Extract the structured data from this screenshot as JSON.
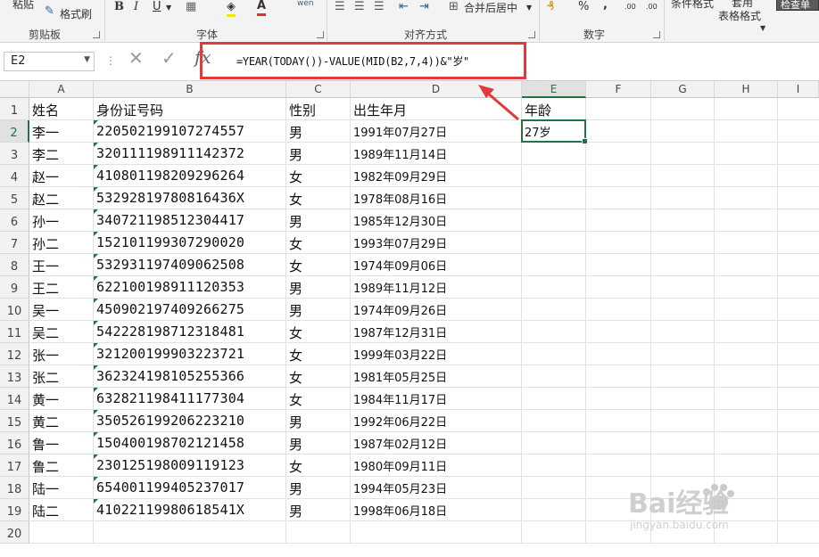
{
  "ribbon": {
    "clipboard": {
      "paste": "粘贴",
      "format_painter": "格式刷",
      "group": "剪贴板"
    },
    "font": {
      "bold": "B",
      "italic": "I",
      "underline": "U",
      "group": "字体",
      "wen": "wén"
    },
    "alignment": {
      "merge_center": "合并后居中",
      "group": "对齐方式"
    },
    "number": {
      "percent": "%",
      "comma": ",",
      "inc_decimal": ".00",
      "dec_decimal": ".00",
      "group": "数字"
    },
    "styles": {
      "conditional": "条件格式",
      "table_format_1": "套用",
      "table_format_2": "表格格式",
      "cell_style": "检查单"
    }
  },
  "formula_bar": {
    "name_box": "E2",
    "formula": "=YEAR(TODAY())-VALUE(MID(B2,7,4))&\"岁\""
  },
  "columns": [
    "A",
    "B",
    "C",
    "D",
    "E",
    "F",
    "G",
    "H",
    "I"
  ],
  "rows": [
    "1",
    "2",
    "3",
    "4",
    "5",
    "6",
    "7",
    "8",
    "9",
    "10",
    "11",
    "12",
    "13",
    "14",
    "15",
    "16",
    "17",
    "18",
    "19",
    "20"
  ],
  "header": {
    "name": "姓名",
    "id": "身份证号码",
    "gender": "性别",
    "birth": "出生年月",
    "age": "年龄"
  },
  "records": [
    {
      "name": "李一",
      "id": "220502199107274557",
      "gender": "男",
      "birth": "1991年07月27日",
      "age": "27岁"
    },
    {
      "name": "李二",
      "id": "320111198911142372",
      "gender": "男",
      "birth": "1989年11月14日",
      "age": ""
    },
    {
      "name": "赵一",
      "id": "410801198209296264",
      "gender": "女",
      "birth": "1982年09月29日",
      "age": ""
    },
    {
      "name": "赵二",
      "id": "53292819780816436X",
      "gender": "女",
      "birth": "1978年08月16日",
      "age": ""
    },
    {
      "name": "孙一",
      "id": "340721198512304417",
      "gender": "男",
      "birth": "1985年12月30日",
      "age": ""
    },
    {
      "name": "孙二",
      "id": "152101199307290020",
      "gender": "女",
      "birth": "1993年07月29日",
      "age": ""
    },
    {
      "name": "王一",
      "id": "532931197409062508",
      "gender": "女",
      "birth": "1974年09月06日",
      "age": ""
    },
    {
      "name": "王二",
      "id": "622100198911120353",
      "gender": "男",
      "birth": "1989年11月12日",
      "age": ""
    },
    {
      "name": "吴一",
      "id": "450902197409266275",
      "gender": "男",
      "birth": "1974年09月26日",
      "age": ""
    },
    {
      "name": "吴二",
      "id": "542228198712318481",
      "gender": "女",
      "birth": "1987年12月31日",
      "age": ""
    },
    {
      "name": "张一",
      "id": "321200199903223721",
      "gender": "女",
      "birth": "1999年03月22日",
      "age": ""
    },
    {
      "name": "张二",
      "id": "362324198105255366",
      "gender": "女",
      "birth": "1981年05月25日",
      "age": ""
    },
    {
      "name": "黄一",
      "id": "632821198411177304",
      "gender": "女",
      "birth": "1984年11月17日",
      "age": ""
    },
    {
      "name": "黄二",
      "id": "350526199206223210",
      "gender": "男",
      "birth": "1992年06月22日",
      "age": ""
    },
    {
      "name": "鲁一",
      "id": "150400198702121458",
      "gender": "男",
      "birth": "1987年02月12日",
      "age": ""
    },
    {
      "name": "鲁二",
      "id": "230125198009119123",
      "gender": "女",
      "birth": "1980年09月11日",
      "age": ""
    },
    {
      "name": "陆一",
      "id": "654001199405237017",
      "gender": "男",
      "birth": "1994年05月23日",
      "age": ""
    },
    {
      "name": "陆二",
      "id": "41022119980618541X",
      "gender": "男",
      "birth": "1998年06月18日",
      "age": ""
    }
  ],
  "watermark": {
    "brand": "Bai经验",
    "url": "jingyan.baidu.com"
  },
  "colors": {
    "accent": "#217346",
    "highlight": "#e03a3a"
  }
}
